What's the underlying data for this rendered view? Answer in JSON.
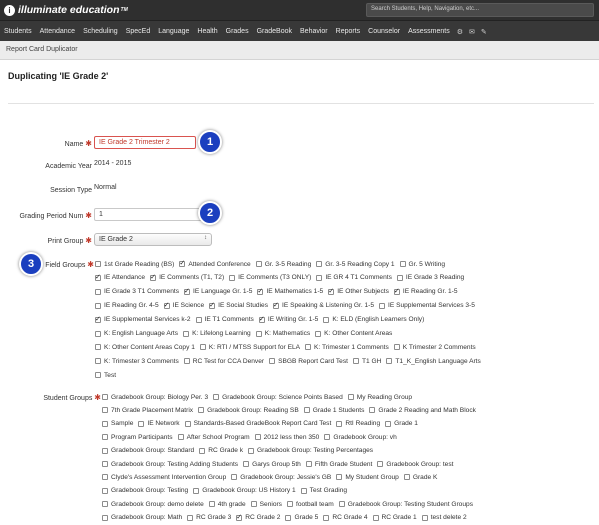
{
  "topbar": {
    "logo_text": "illuminate education",
    "logo_tm": "TM",
    "search_placeholder": "Search Students, Help, Navigation, etc..."
  },
  "nav": {
    "items": [
      "Students",
      "Attendance",
      "Scheduling",
      "SpecEd",
      "Language",
      "Health",
      "Grades",
      "GradeBook",
      "Behavior",
      "Reports",
      "Counselor",
      "Assessments"
    ],
    "icons": [
      "gear-icon",
      "mail-icon",
      "wrench-icon"
    ]
  },
  "breadcrumb": "Report Card Duplicator",
  "page_title": "Duplicating 'IE Grade 2'",
  "form": {
    "name_label": "Name",
    "name_value": "IE Grade 2 Trimester 2",
    "academic_year_label": "Academic Year",
    "academic_year_value": "2014 - 2015",
    "session_type_label": "Session Type",
    "session_type_value": "Normal",
    "grading_period_label": "Grading Period Num",
    "grading_period_value": "1",
    "print_group_label": "Print Group",
    "print_group_value": "IE Grade 2",
    "field_groups_label": "Field Groups",
    "student_groups_label": "Student Groups",
    "required_mark": "✱"
  },
  "callouts": [
    "1",
    "2",
    "3"
  ],
  "field_groups": [
    [
      {
        "label": "1st Grade Reading (BS)",
        "checked": false
      },
      {
        "label": "Attended Conference",
        "checked": true
      },
      {
        "label": "Gr. 3-5 Reading",
        "checked": false
      },
      {
        "label": "Gr. 3-5 Reading Copy 1",
        "checked": false
      },
      {
        "label": "Gr. 5 Writing",
        "checked": false
      }
    ],
    [
      {
        "label": "IE Attendance",
        "checked": true
      },
      {
        "label": "IE Comments (T1, T2)",
        "checked": true
      },
      {
        "label": "IE Comments (T3 ONLY)",
        "checked": false
      },
      {
        "label": "IE GR 4 T1 Comments",
        "checked": false
      },
      {
        "label": "IE Grade 3 Reading",
        "checked": false
      }
    ],
    [
      {
        "label": "IE Grade 3 T1 Comments",
        "checked": false
      },
      {
        "label": "IE Language Gr. 1-5",
        "checked": true
      },
      {
        "label": "IE Mathematics 1-5",
        "checked": true
      },
      {
        "label": "IE Other Subjects",
        "checked": true
      },
      {
        "label": "IE Reading Gr. 1-5",
        "checked": true
      }
    ],
    [
      {
        "label": "IE Reading Gr. 4-5",
        "checked": false
      },
      {
        "label": "IE Science",
        "checked": true
      },
      {
        "label": "IE Social Studies",
        "checked": true
      },
      {
        "label": "IE Speaking & Listening Gr. 1-5",
        "checked": true
      },
      {
        "label": "IE Supplemental Services 3-5",
        "checked": false
      }
    ],
    [
      {
        "label": "IE Supplemental Services k-2",
        "checked": true
      },
      {
        "label": "IE T1 Comments",
        "checked": false
      },
      {
        "label": "IE Writing Gr. 1-5",
        "checked": true
      },
      {
        "label": "K: ELD (English Learners Only)",
        "checked": false
      }
    ],
    [
      {
        "label": "K: English Language Arts",
        "checked": false
      },
      {
        "label": "K: Lifelong Learning",
        "checked": false
      },
      {
        "label": "K: Mathematics",
        "checked": false
      },
      {
        "label": "K: Other Content Areas",
        "checked": false
      }
    ],
    [
      {
        "label": "K: Other Content Areas Copy 1",
        "checked": false
      },
      {
        "label": "K: RTI / MTSS Support for ELA",
        "checked": false
      },
      {
        "label": "K: Trimester 1 Comments",
        "checked": false
      },
      {
        "label": "K Trimester 2 Comments",
        "checked": false
      }
    ],
    [
      {
        "label": "K: Trimester 3 Comments",
        "checked": false
      },
      {
        "label": "RC Test for CCA Denver",
        "checked": false
      },
      {
        "label": "SBGB Report Card Test",
        "checked": false
      },
      {
        "label": "T1 GH",
        "checked": false
      },
      {
        "label": "T1_K_English Language Arts",
        "checked": false
      }
    ],
    [
      {
        "label": "Test",
        "checked": false
      }
    ]
  ],
  "student_groups": [
    [
      {
        "label": "Gradebook Group: Biology Per. 3",
        "checked": false
      },
      {
        "label": "Gradebook Group: Science Points Based",
        "checked": false
      },
      {
        "label": "My Reading Group",
        "checked": false
      }
    ],
    [
      {
        "label": "7th Grade Placement Matrix",
        "checked": false
      },
      {
        "label": "Gradebook Group: Reading SB",
        "checked": false
      },
      {
        "label": "Grade 1 Students",
        "checked": false
      },
      {
        "label": "Grade 2 Reading and Math Block",
        "checked": false
      }
    ],
    [
      {
        "label": "Sample",
        "checked": false
      },
      {
        "label": "IE Network",
        "checked": false
      },
      {
        "label": "Standards-Based GradeBook Report Card Test",
        "checked": false
      },
      {
        "label": "RtI Reading",
        "checked": false
      },
      {
        "label": "Grade 1",
        "checked": false
      }
    ],
    [
      {
        "label": "Program Participants",
        "checked": false
      },
      {
        "label": "After School Program",
        "checked": false
      },
      {
        "label": "2012 less then 350",
        "checked": false
      },
      {
        "label": "Gradebook Group: vh",
        "checked": false
      }
    ],
    [
      {
        "label": "Gradebook Group: Standard",
        "checked": false
      },
      {
        "label": "RC Grade k",
        "checked": false
      },
      {
        "label": "Gradebook Group: Testing Percentages",
        "checked": false
      }
    ],
    [
      {
        "label": "Gradebook Group: Testing Adding Students",
        "checked": false
      },
      {
        "label": "Garys Group 5th",
        "checked": false
      },
      {
        "label": "Fifth Grade Student",
        "checked": false
      },
      {
        "label": "Gradebook Group: test",
        "checked": false
      }
    ],
    [
      {
        "label": "Clyde's Assessment Intervention Group",
        "checked": false
      },
      {
        "label": "Gradebook Group: Jessie's GB",
        "checked": false
      },
      {
        "label": "My Student Group",
        "checked": false
      },
      {
        "label": "Grade K",
        "checked": false
      }
    ],
    [
      {
        "label": "Gradebook Group: Testing",
        "checked": false
      },
      {
        "label": "Gradebook Group: US History 1",
        "checked": false
      },
      {
        "label": "Test Grading",
        "checked": false
      }
    ],
    [
      {
        "label": "Gradebook Group: demo delete",
        "checked": false
      },
      {
        "label": "4th grade",
        "checked": false
      },
      {
        "label": "Seniors",
        "checked": false
      },
      {
        "label": "football team",
        "checked": false
      },
      {
        "label": "Gradebook Group: Testing Student Groups",
        "checked": false
      }
    ],
    [
      {
        "label": "Gradebook Group: Math",
        "checked": false
      },
      {
        "label": "RC Grade 3",
        "checked": false
      },
      {
        "label": "RC Grade 2",
        "checked": true
      },
      {
        "label": "Grade 5",
        "checked": false
      },
      {
        "label": "RC Grade 4",
        "checked": false
      },
      {
        "label": "RC Grade 1",
        "checked": false
      },
      {
        "label": "test delete 2",
        "checked": false
      }
    ]
  ]
}
